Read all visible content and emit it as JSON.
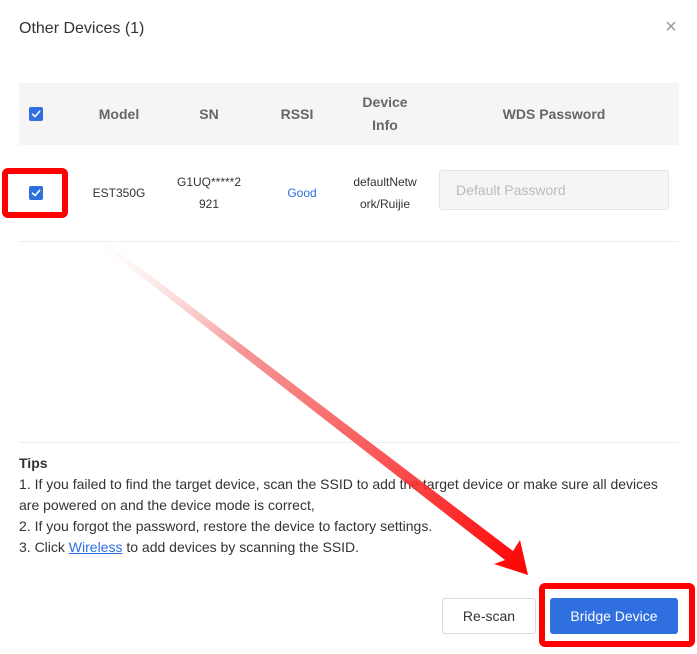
{
  "dialog": {
    "title": "Other Devices (1)",
    "close_glyph": "×"
  },
  "table": {
    "headers": {
      "model": "Model",
      "sn": "SN",
      "rssi": "RSSI",
      "device_info_line1": "Device",
      "device_info_line2": "Info",
      "wds_password": "WDS Password"
    },
    "rows": [
      {
        "checked": true,
        "model": "EST350G",
        "sn_line1": "G1UQ*****2",
        "sn_line2": "921",
        "rssi": "Good",
        "info_line1": "defaultNetw",
        "info_line2": "ork/Ruijie",
        "password_placeholder": "Default Password"
      }
    ]
  },
  "tips": {
    "title": "Tips",
    "line1": "1. If you failed to find the target device, scan the SSID to add the target device or make sure all devices are powered on and the device mode is correct,",
    "line2": "2. If you forgot the password, restore the device to factory settings.",
    "line3_prefix": "3. Click ",
    "line3_link": "Wireless",
    "line3_suffix": " to add devices by scanning the SSID."
  },
  "buttons": {
    "rescan": "Re-scan",
    "bridge": "Bridge Device"
  },
  "colors": {
    "accent": "#2f6fe0",
    "annotation": "#ff0000"
  },
  "icons": [
    "checkbox-icon",
    "close-icon"
  ]
}
